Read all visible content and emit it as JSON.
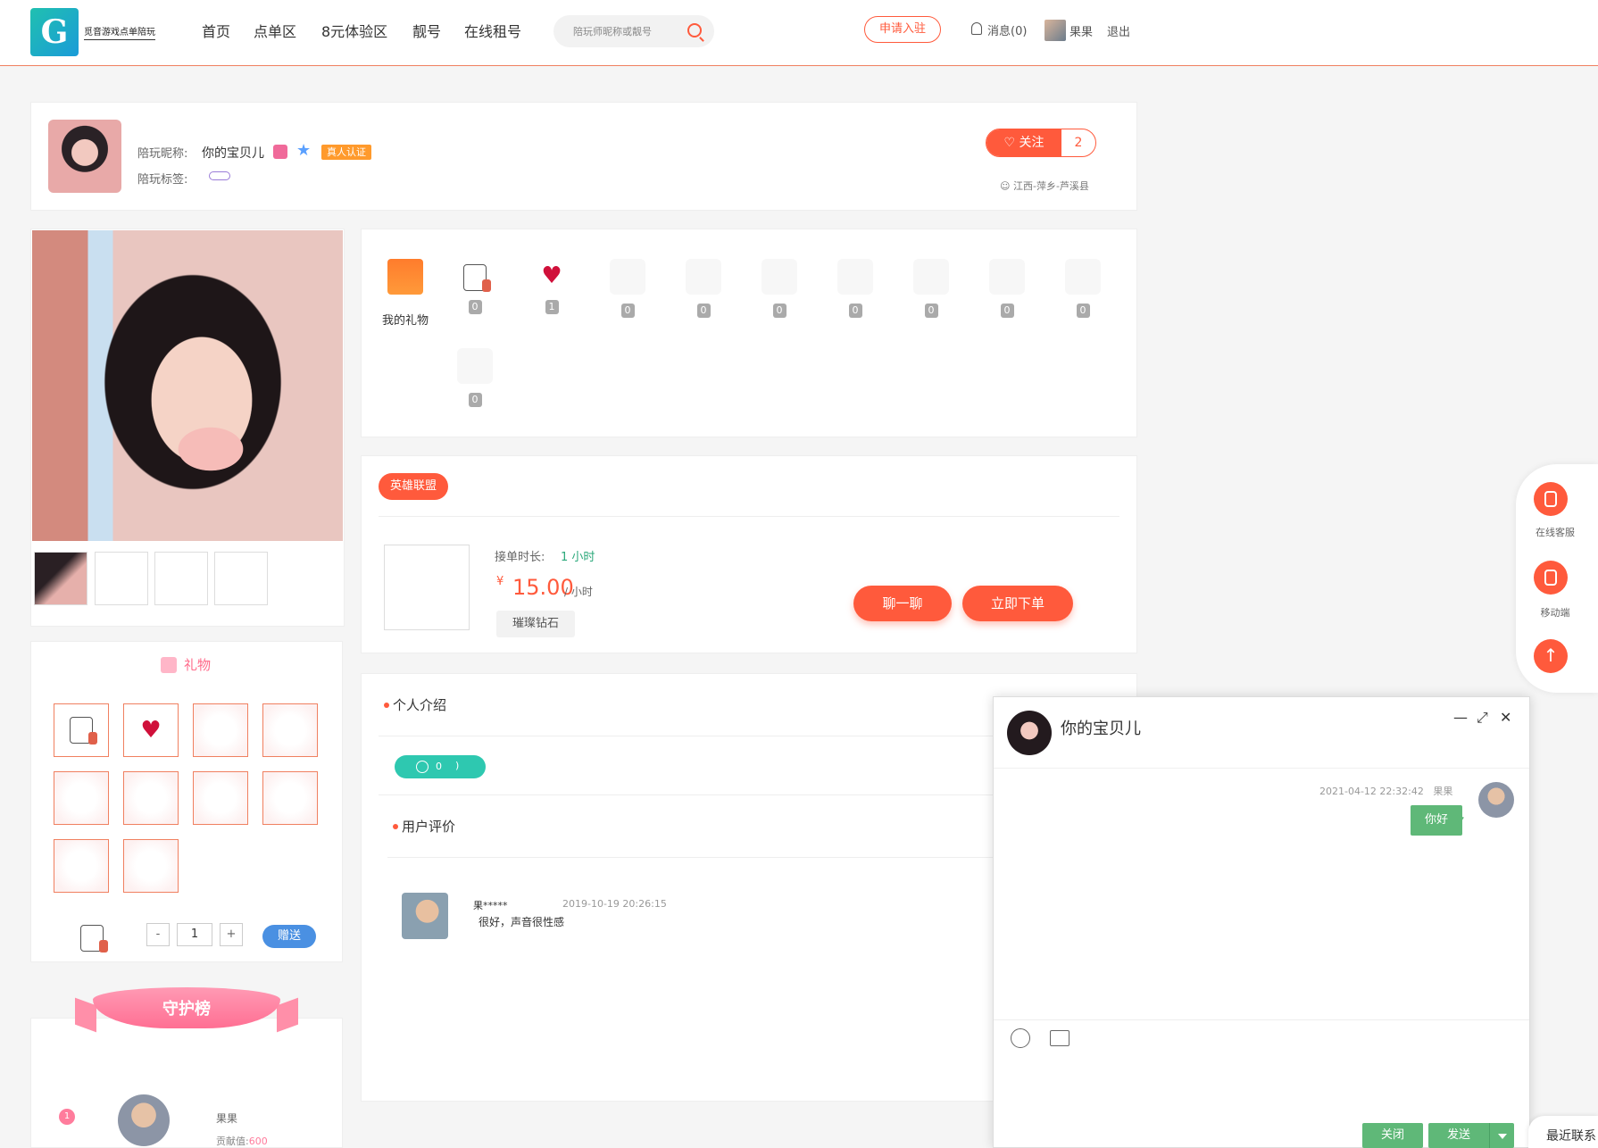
{
  "header": {
    "logo_text": "觅音游戏点单陪玩",
    "nav": [
      "首页",
      "点单区",
      "8元体验区",
      "靓号",
      "在线租号"
    ],
    "search_placeholder": "陪玩师昵称或靓号",
    "apply_label": "申请入驻",
    "messages_label": "消息(0)",
    "username": "果果",
    "logout_label": "退出"
  },
  "profile": {
    "nickname_label": "陪玩昵称:",
    "nickname": "你的宝贝儿",
    "cert_label": "真人认证",
    "tags_label": "陪玩标签:",
    "follow_label": "关注",
    "follow_count": "2",
    "location": "江西-萍乡-芦溪县"
  },
  "gift_wall": {
    "label": "我的礼物",
    "counts": [
      "0",
      "1",
      "0",
      "0",
      "0",
      "0",
      "0",
      "0",
      "0",
      "0"
    ]
  },
  "gift_panel": {
    "title": "礼物",
    "quantity": "1",
    "minus": "-",
    "plus": "+",
    "send_label": "赠送"
  },
  "guard": {
    "title": "守护榜",
    "rank": "1",
    "name": "果果",
    "contrib_label": "贡献值:",
    "contrib_value": "600"
  },
  "service": {
    "game_tag": "英雄联盟",
    "duration_label": "接单时长:",
    "duration_value": "1 小时",
    "currency": "¥",
    "price": "15.00",
    "price_unit": "/ 小时",
    "rank_tag": "璀璨钻石",
    "chat_label": "聊一聊",
    "order_label": "立即下单"
  },
  "intro": {
    "title": "个人介绍",
    "voice_count": "0",
    "reviews_title": "用户评价",
    "review": {
      "name": "果*****",
      "time": "2019-10-19 20:26:15",
      "text": "很好，声音很性感"
    }
  },
  "float_menu": {
    "service_label": "在线客服",
    "mobile_label": "移动端"
  },
  "chat": {
    "title": "你的宝贝儿",
    "message_time": "2021-04-12 22:32:42",
    "message_sender": "果果",
    "message_text": "你好",
    "close_label": "关闭",
    "send_label": "发送",
    "recent_label": "最近联系"
  },
  "colors": {
    "accent": "#ff5a3c",
    "chat_green": "#5fb878",
    "voice_teal": "#2ec8b0",
    "pink": "#ff7c9c"
  }
}
